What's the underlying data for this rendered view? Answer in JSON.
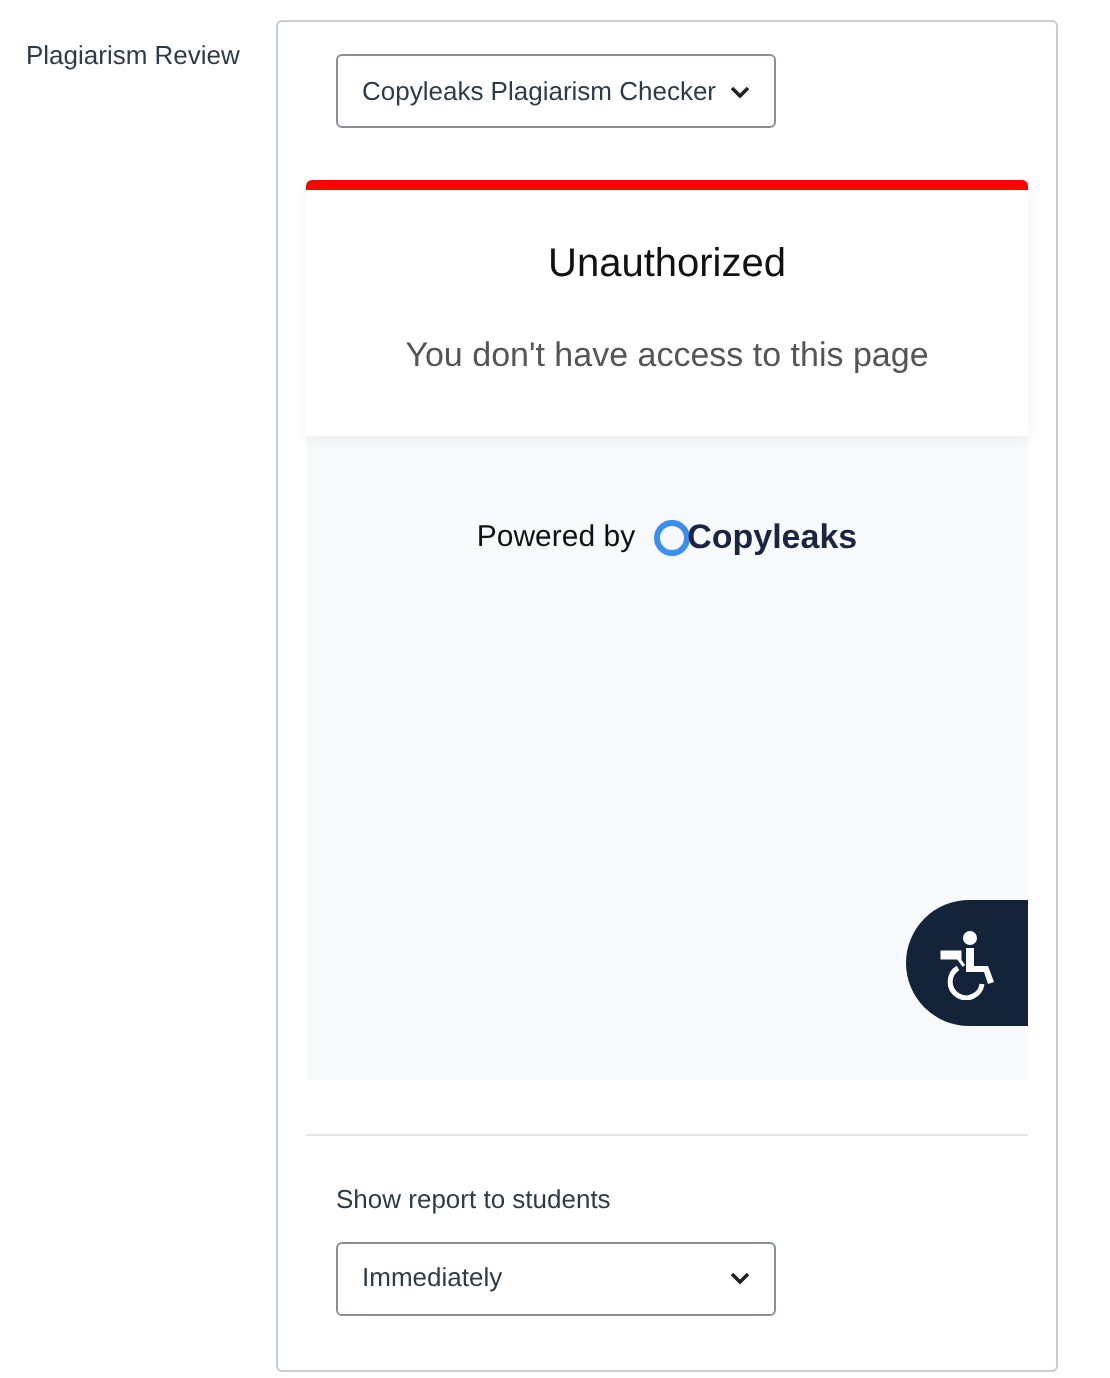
{
  "field_label": "Plagiarism Review",
  "review_select": {
    "value": "Copyleaks Plagiarism Checker"
  },
  "error": {
    "title": "Unauthorized",
    "message": "You don't have access to this page"
  },
  "powered_by": {
    "text": "Powered by",
    "brand": "Copyleaks"
  },
  "report_label": "Show report to students",
  "report_select": {
    "value": "Immediately"
  }
}
